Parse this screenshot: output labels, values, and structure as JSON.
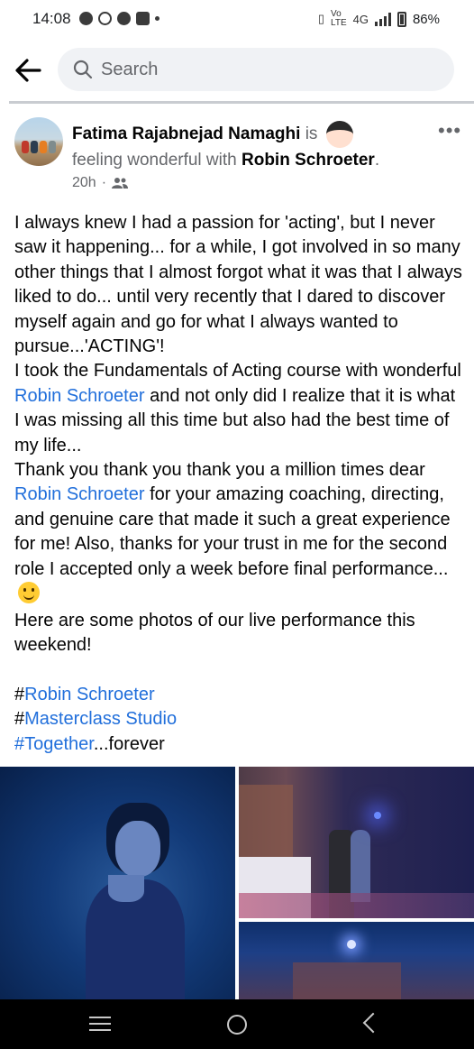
{
  "status_bar": {
    "time": "14:08",
    "network": "4G",
    "battery": "86%"
  },
  "search": {
    "placeholder": "Search"
  },
  "post": {
    "author": "Fatima Rajabnejad Namaghi",
    "is_text": "is",
    "feeling_text": "feeling wonderful with",
    "tagged": "Robin Schroeter",
    "timestamp": "20h",
    "audience_icon": "friends-icon",
    "body": {
      "l1": "I always knew I had a passion for 'acting', but I never saw it happening... for a while, I got involved in so many other things that I almost forgot what it was that I always liked to do... until very recently that I dared to discover myself again and go for what I always wanted to pursue...'ACTING'!",
      "l2a": "I took the Fundamentals of Acting course with wonderful ",
      "l2_link": "Robin Schroeter",
      "l2b": " and not only did I realize that it is what I was missing all this time but also had the best time of my life...",
      "l3a": "Thank you thank you thank you a million times dear ",
      "l3_link": "Robin Schroeter",
      "l3b": " for your amazing coaching, directing, and genuine care that made it such a great experience for me! Also, thanks for your trust in me for the second role I accepted only a week before final performance...",
      "l4": "Here are some photos of our live performance this weekend!",
      "hash": "#",
      "tag1": "Robin Schroeter",
      "tag2": "Masterclass Studio",
      "tag3": "#Together",
      "tag3_suffix": "...forever"
    }
  },
  "colors": {
    "link": "#216fdb",
    "muted": "#65676b"
  }
}
